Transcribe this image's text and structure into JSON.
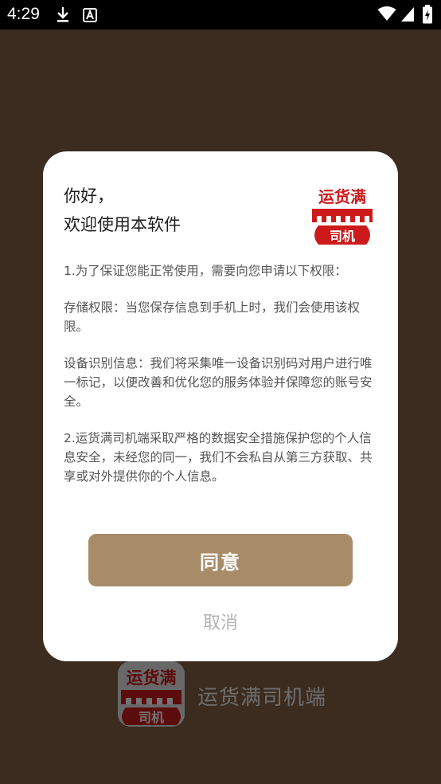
{
  "status_bar": {
    "time": "4:29"
  },
  "dialog": {
    "greeting_line1": "你好，",
    "greeting_line2": "欢迎使用本软件",
    "logo_text_top": "运货满",
    "logo_text_bottom": "司机",
    "paragraphs": [
      "1.为了保证您能正常使用，需要向您申请以下权限：",
      "存储权限：当您保存信息到手机上时，我们会使用该权限。",
      "设备识别信息：我们将采集唯一设备识别码对用户进行唯一标记，以便改善和优化您的服务体验并保障您的账号安全。",
      "2.运货满司机端采取严格的数据安全措施保护您的个人信息安全，未经您的同一，我们不会私自从第三方获取、共享或对外提供你的个人信息。"
    ],
    "agree_label": "同意",
    "cancel_label": "取消"
  },
  "background": {
    "brand_name": "运货满司机端",
    "logo_text_top": "运货满",
    "logo_text_bottom": "司机"
  },
  "colors": {
    "backdrop": "#3b2c1f",
    "agree_button": "#a88c69",
    "logo_red": "#cc1a1a"
  }
}
